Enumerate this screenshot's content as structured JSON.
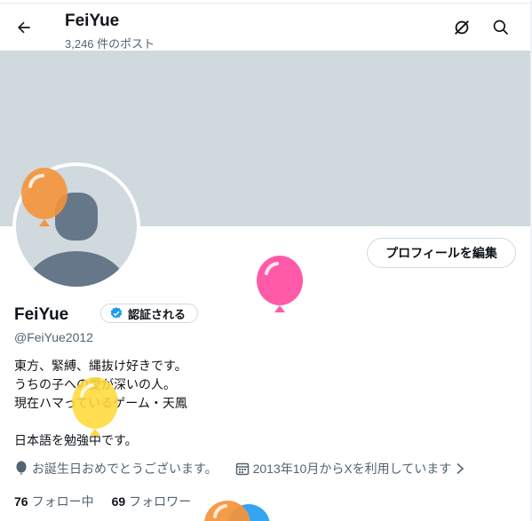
{
  "header": {
    "title": "FeiYue",
    "post_count": "3,246 件のポスト",
    "icons": [
      "back-arrow-icon",
      "grok-icon",
      "search-icon"
    ]
  },
  "profile": {
    "edit_button": "プロフィールを編集",
    "name": "FeiYue",
    "verify_badge": "認証される",
    "handle": "@FeiYue2012",
    "bio": "東方、緊縛、縄抜け好きです。\nうちの子への愛が深いの人。\n現在ハマっているゲーム・天鳳\n\n日本語を勉強中です。",
    "birthday": "お誕生日おめでとうございます。",
    "joined": "2013年10月からXを利用しています",
    "following_count": "76",
    "following_label": "フォロー中",
    "followers_count": "69",
    "followers_label": "フォロワー"
  },
  "colors": {
    "banner": "#cfd9de",
    "verified": "#1d9bf0",
    "balloons": [
      "#f4943a",
      "#ff5aa8",
      "#ffd93a",
      "#f4943a",
      "#1d9bf0"
    ]
  }
}
